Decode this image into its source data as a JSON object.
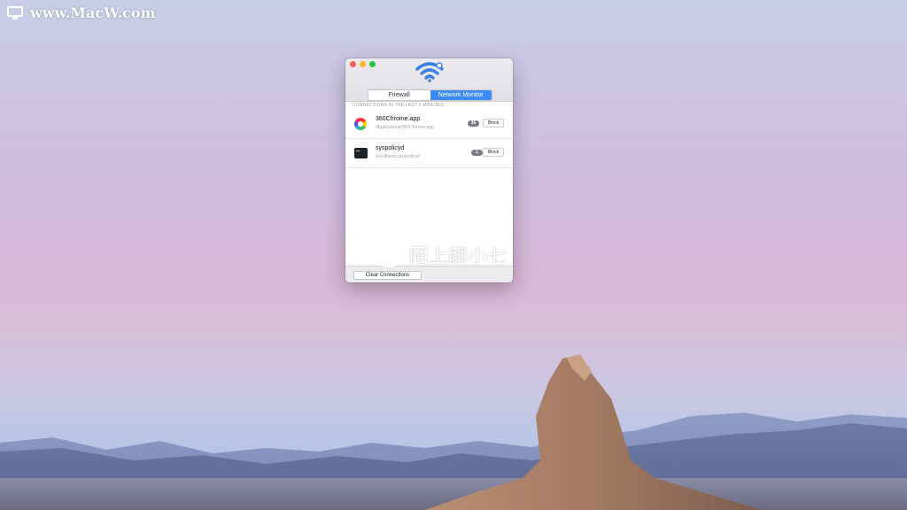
{
  "watermark": {
    "text": "www.MacW.com",
    "icon": "monitor-icon"
  },
  "window": {
    "app_icon": "wifi-shield-icon",
    "tabs": [
      {
        "label": "Firewall",
        "active": false
      },
      {
        "label": "Network Monitor",
        "active": true
      }
    ],
    "section_header": "CONNECTIONS IN THE LAST 2 MINUTES",
    "connections": [
      {
        "name": "360Chrome.app",
        "path": "/Applications/360Chrome.app",
        "count": "36",
        "action": "Block",
        "icon": "chrome-icon"
      },
      {
        "name": "syspolicyd",
        "path": "/usr/libexec/syspolicyd",
        "count": "1",
        "action": "Block",
        "icon": "terminal-icon"
      }
    ],
    "clear_button": "Clear Connections"
  },
  "overlay": {
    "text": "陌上颜小七",
    "icon": "weibo-icon"
  },
  "colors": {
    "accent": "#3b8cf6",
    "close": "#fc5f57",
    "minimize": "#fdbc2e",
    "zoom": "#28c840"
  }
}
